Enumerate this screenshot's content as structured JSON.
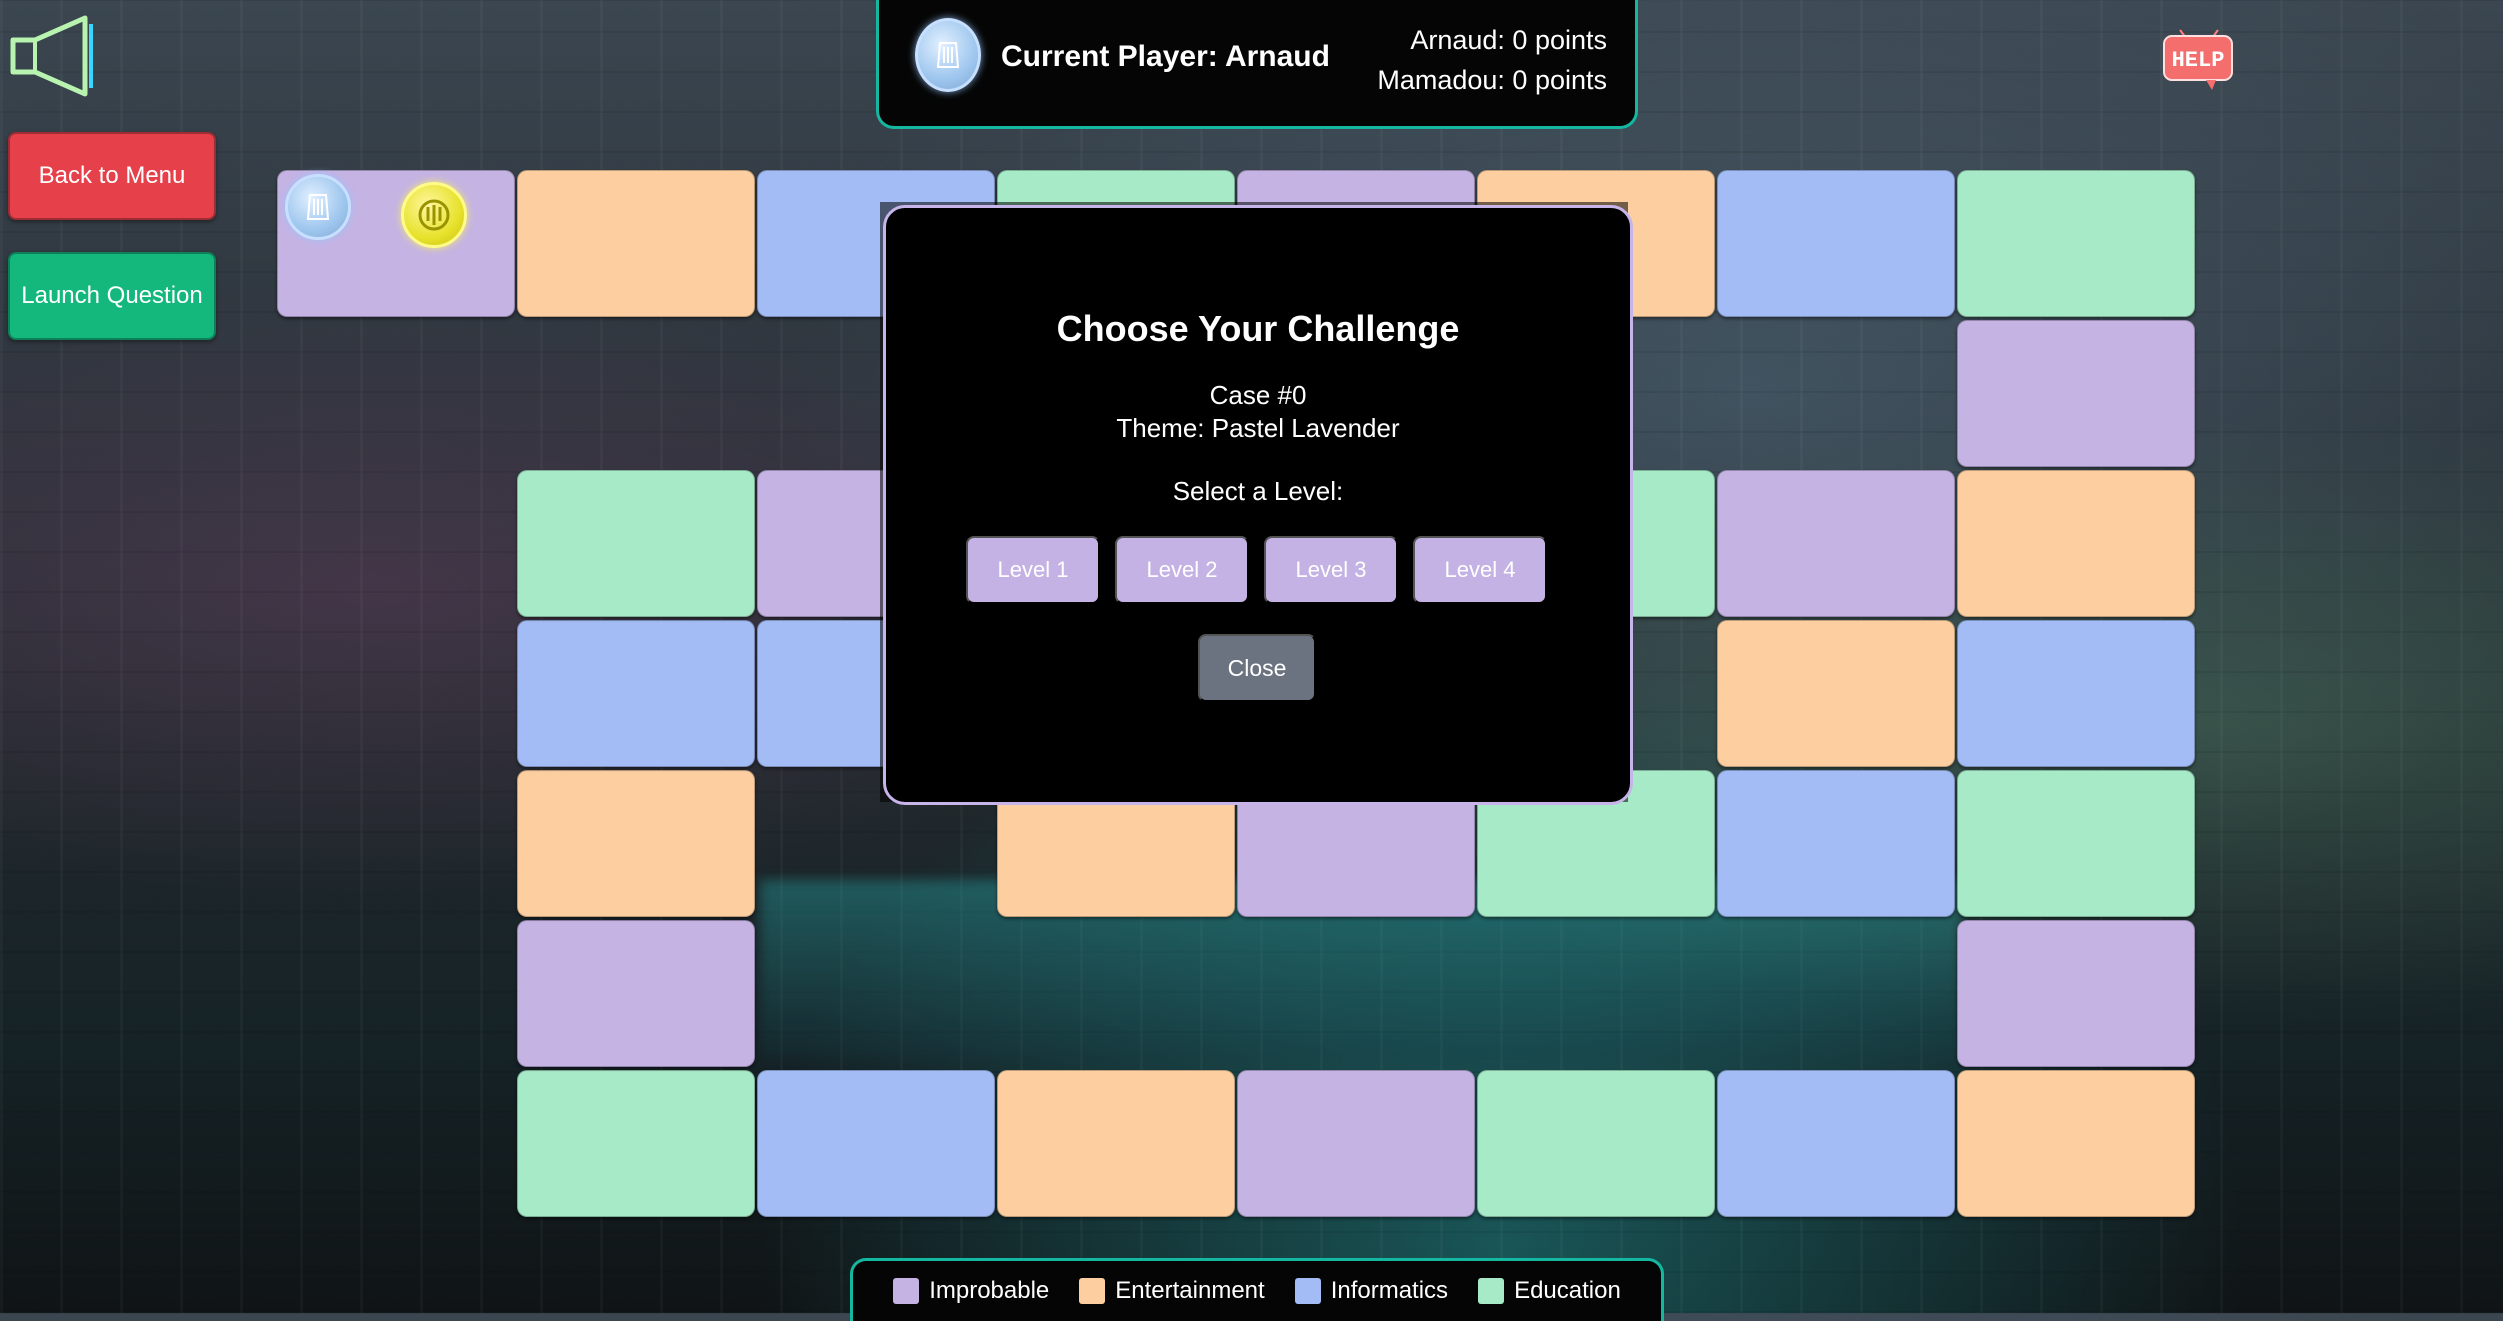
{
  "colors": {
    "improbable": "#c5b3e3",
    "entertainment": "#fdcfa0",
    "informatics": "#a3bcf5",
    "education": "#a7eac7",
    "accent": "#14b8a0",
    "danger": "#e6404a",
    "success": "#14b87d"
  },
  "sidebar": {
    "back_label": "Back to Menu",
    "launch_label": "Launch Question"
  },
  "icons": {
    "sound": "speaker-icon",
    "help": "help-icon",
    "help_text": "HELP"
  },
  "header": {
    "current_player": "Current Player: Arnaud",
    "scores": [
      "Arnaud: 0 points",
      "Mamadou: 0 points"
    ]
  },
  "board": {
    "tiles": [
      "improbable",
      "entertainment",
      "informatics",
      "education",
      "improbable",
      "entertainment",
      "informatics",
      "education",
      "improbable",
      "entertainment",
      "informatics",
      "education",
      "improbable",
      "entertainment",
      "informatics",
      "education",
      "improbable",
      "entertainment",
      "informatics",
      "education",
      "improbable",
      "entertainment",
      "informatics",
      "education",
      "improbable",
      "entertainment",
      "informatics",
      "education",
      "improbable",
      "entertainment",
      "informatics",
      "education",
      "improbable",
      "entertainment",
      "informatics",
      "education",
      "improbable",
      "entertainment",
      "informatics",
      "education"
    ],
    "pawns": [
      {
        "player": "Arnaud",
        "icon": "blue-pawn-icon",
        "tile": 0
      },
      {
        "player": "Mamadou",
        "icon": "yellow-pawn-icon",
        "tile": 0
      }
    ]
  },
  "modal": {
    "title": "Choose Your Challenge",
    "case": "Case #0",
    "theme": "Theme: Pastel Lavender",
    "select_prompt": "Select a Level:",
    "levels": [
      "Level 1",
      "Level 2",
      "Level 3",
      "Level 4"
    ],
    "close_label": "Close"
  },
  "legend": [
    {
      "label": "Improbable",
      "color": "#c5b3e3"
    },
    {
      "label": "Entertainment",
      "color": "#fdcfa0"
    },
    {
      "label": "Informatics",
      "color": "#a3bcf5"
    },
    {
      "label": "Education",
      "color": "#a7eac7"
    }
  ]
}
